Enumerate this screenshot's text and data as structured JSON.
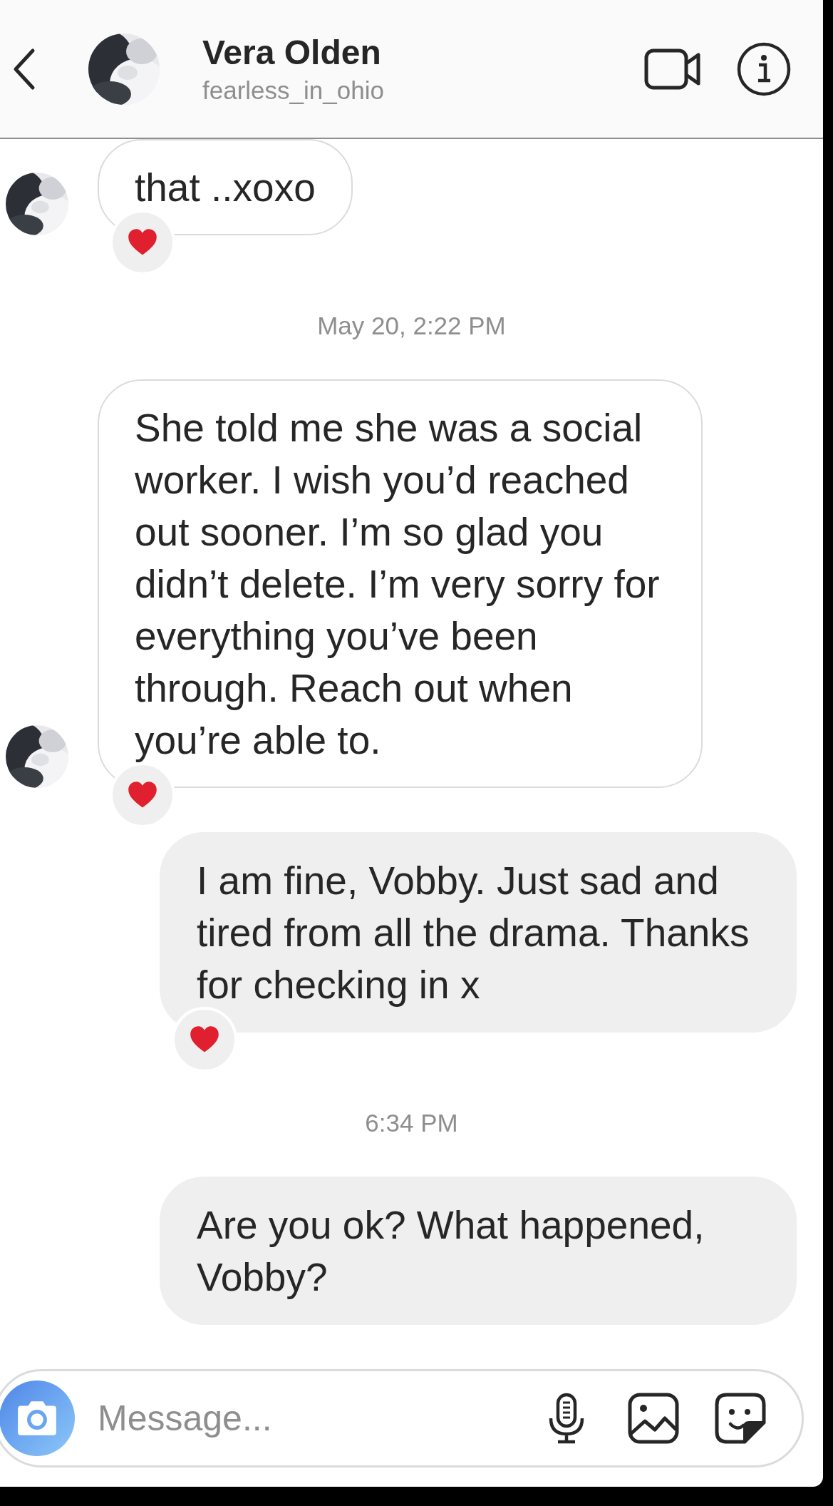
{
  "header": {
    "title": "Vera Olden",
    "subtitle": "fearless_in_ohio"
  },
  "messages": [
    {
      "kind": "incoming",
      "text": "that ..xoxo",
      "avatar": true,
      "reacted": true
    },
    {
      "kind": "timestamp",
      "text": "May 20, 2:22 PM"
    },
    {
      "kind": "incoming",
      "text": "She told me she was a social worker. I wish you’d reached out sooner. I’m so glad you didn’t delete. I’m very sorry for everything you’ve been through. Reach out when you’re able to.",
      "avatar": true,
      "reacted": true
    },
    {
      "kind": "outgoing",
      "text": "I am fine, Vobby. Just sad and tired from all the drama. Thanks for checking in x",
      "avatar": false,
      "reacted": true
    },
    {
      "kind": "timestamp",
      "text": "6:34 PM"
    },
    {
      "kind": "outgoing",
      "text": "Are you ok? What happened, Vobby?",
      "avatar": false,
      "reacted": false
    }
  ],
  "composer": {
    "placeholder": "Message..."
  }
}
